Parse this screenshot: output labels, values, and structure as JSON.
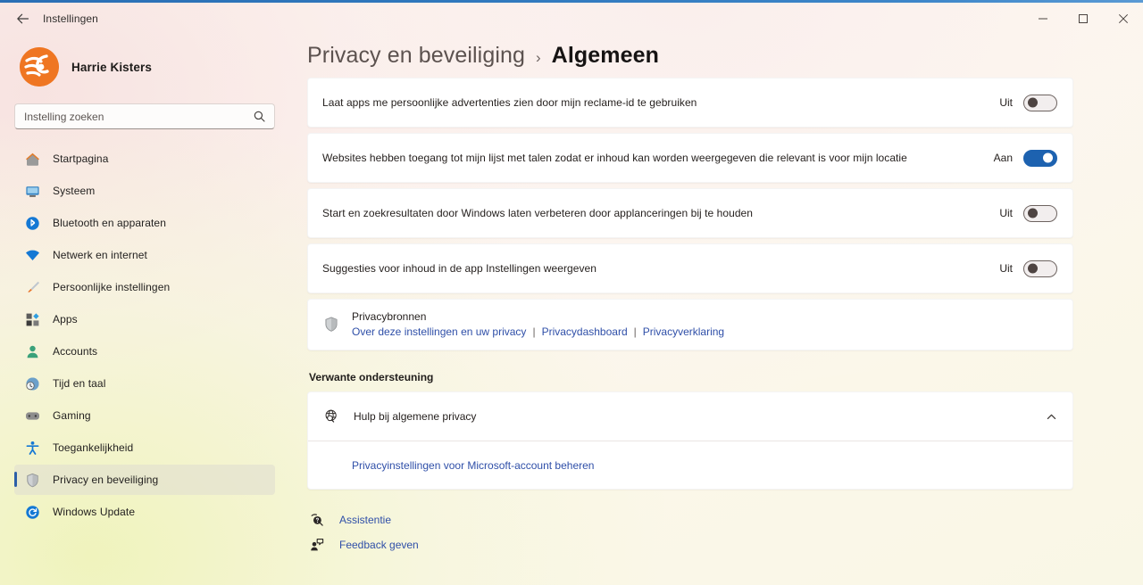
{
  "window": {
    "app_title": "Instellingen",
    "back_icon": "arrow-left-icon",
    "minimize_label": "−",
    "maximize_label": "□",
    "close_label": "✕",
    "accent_color": "#2a6fb5"
  },
  "sidebar": {
    "profile": {
      "name": "Harrie Kisters",
      "avatar_icon": "user-avatar-logo",
      "avatar_color": "#ef7622"
    },
    "search": {
      "placeholder": "Instelling zoeken",
      "value": "",
      "icon": "search-icon"
    },
    "items": [
      {
        "label": "Startpagina",
        "icon": "home-icon",
        "selected": false
      },
      {
        "label": "Systeem",
        "icon": "monitor-icon",
        "selected": false
      },
      {
        "label": "Bluetooth en apparaten",
        "icon": "bluetooth-icon",
        "selected": false
      },
      {
        "label": "Netwerk en internet",
        "icon": "wifi-icon",
        "selected": false
      },
      {
        "label": "Persoonlijke instellingen",
        "icon": "paintbrush-icon",
        "selected": false
      },
      {
        "label": "Apps",
        "icon": "apps-grid-icon",
        "selected": false
      },
      {
        "label": "Accounts",
        "icon": "person-icon",
        "selected": false
      },
      {
        "label": "Tijd en taal",
        "icon": "clock-globe-icon",
        "selected": false
      },
      {
        "label": "Gaming",
        "icon": "gamepad-icon",
        "selected": false
      },
      {
        "label": "Toegankelijkheid",
        "icon": "accessibility-icon",
        "selected": false
      },
      {
        "label": "Privacy en beveiliging",
        "icon": "shield-icon",
        "selected": true
      },
      {
        "label": "Windows Update",
        "icon": "update-refresh-icon",
        "selected": false
      }
    ]
  },
  "main": {
    "breadcrumb": {
      "parent": "Privacy en beveiliging",
      "separator": "›",
      "current": "Algemeen"
    },
    "settings": [
      {
        "label": "Laat apps me persoonlijke advertenties zien door mijn reclame-id te gebruiken",
        "state_label": "Uit",
        "state": "off"
      },
      {
        "label": "Websites hebben toegang tot mijn lijst met talen zodat er inhoud kan worden weergegeven die relevant is voor mijn locatie",
        "state_label": "Aan",
        "state": "on"
      },
      {
        "label": "Start en zoekresultaten door Windows laten verbeteren door applanceringen bij te houden",
        "state_label": "Uit",
        "state": "off"
      },
      {
        "label": "Suggesties voor inhoud in de app Instellingen weergeven",
        "state_label": "Uit",
        "state": "off"
      }
    ],
    "privacy_resources": {
      "icon": "shield-icon",
      "title": "Privacybronnen",
      "links": [
        "Over deze instellingen en uw privacy",
        "Privacydashboard",
        "Privacyverklaring"
      ],
      "divider": "|",
      "link_color": "#2f4fa8"
    },
    "related_support": {
      "heading": "Verwante ondersteuning",
      "item": {
        "icon": "globe-search-icon",
        "title": "Hulp bij algemene privacy",
        "expand_icon": "chevron-up-icon",
        "expanded": true,
        "link": "Privacyinstellingen voor Microsoft-account beheren"
      }
    },
    "footer": [
      {
        "label": "Assistentie",
        "icon": "help-search-icon"
      },
      {
        "label": "Feedback geven",
        "icon": "feedback-person-icon"
      }
    ]
  }
}
